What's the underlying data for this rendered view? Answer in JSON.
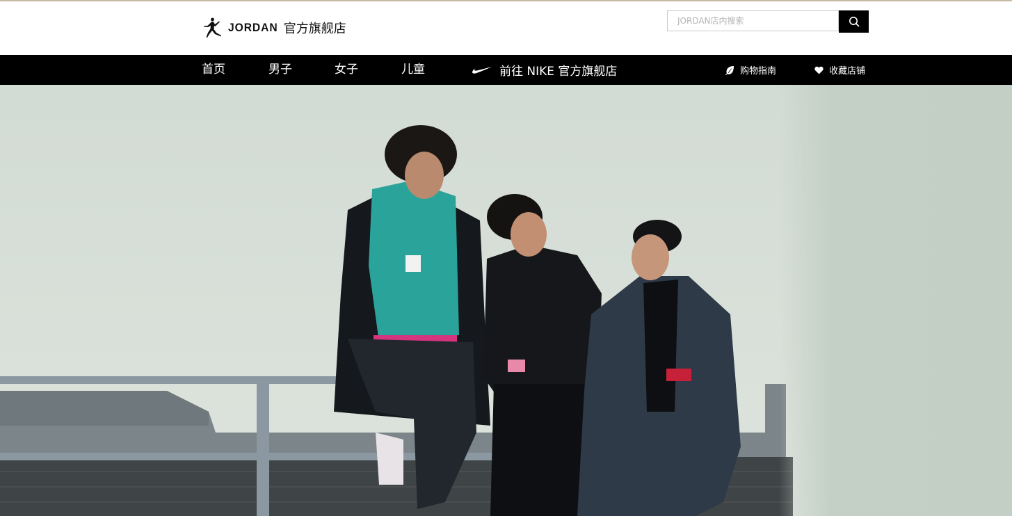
{
  "header": {
    "logo": {
      "brand": "JORDAN",
      "store_name": "官方旗舰店"
    },
    "search": {
      "placeholder": "JORDAN店内搜索",
      "value": ""
    }
  },
  "nav": {
    "items": [
      {
        "label": "首页"
      },
      {
        "label": "男子"
      },
      {
        "label": "女子"
      },
      {
        "label": "儿童"
      }
    ],
    "nike_link": {
      "label": "前往 NIKE 官方旗舰店"
    },
    "shopping_guide": {
      "label": "购物指南",
      "icon": "leaf-icon"
    },
    "favorite_store": {
      "label": "收藏店铺",
      "icon": "heart-icon"
    }
  },
  "hero": {
    "description_icon": "banner-image",
    "colors": {
      "wall": "#dbe3dc",
      "rail": "#8e9aa3",
      "brick": "#4b4f52"
    }
  },
  "colors": {
    "nav_bg": "#000000",
    "header_bg": "#ffffff",
    "accent": "#000000"
  }
}
